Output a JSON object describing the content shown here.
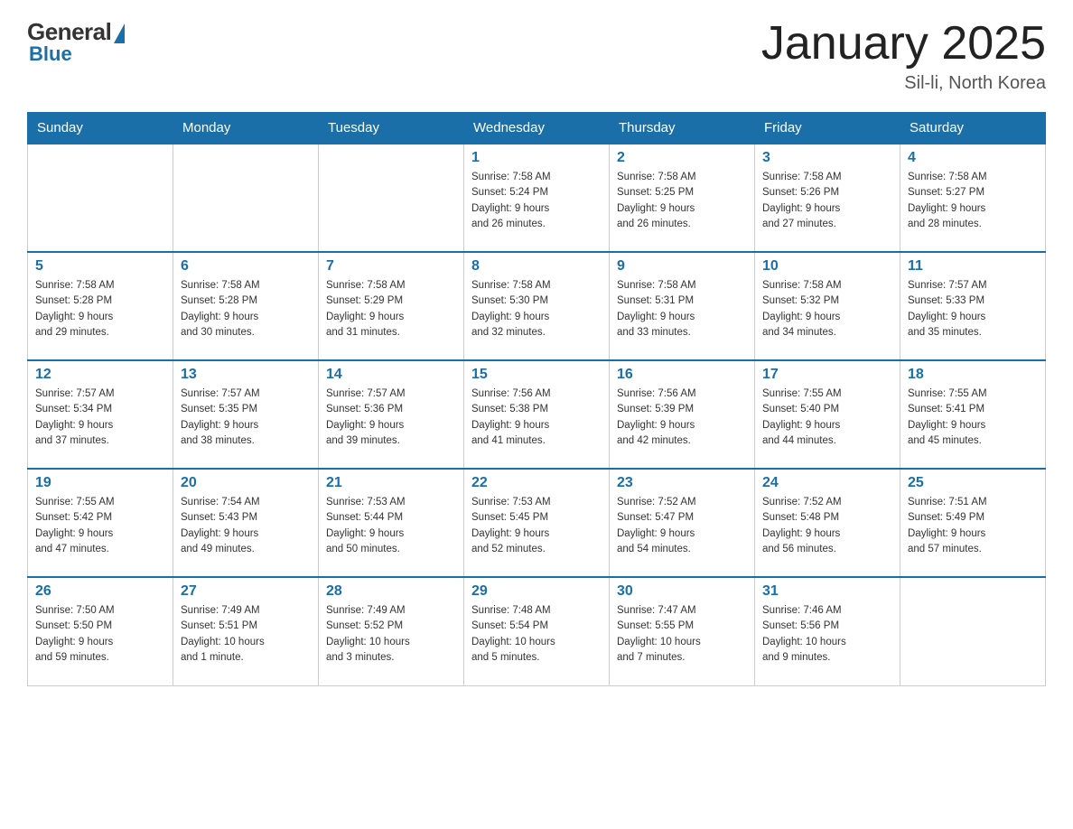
{
  "header": {
    "logo_general": "General",
    "logo_blue": "Blue",
    "month_title": "January 2025",
    "location": "Sil-li, North Korea"
  },
  "days_of_week": [
    "Sunday",
    "Monday",
    "Tuesday",
    "Wednesday",
    "Thursday",
    "Friday",
    "Saturday"
  ],
  "weeks": [
    [
      {
        "day": "",
        "info": ""
      },
      {
        "day": "",
        "info": ""
      },
      {
        "day": "",
        "info": ""
      },
      {
        "day": "1",
        "info": "Sunrise: 7:58 AM\nSunset: 5:24 PM\nDaylight: 9 hours\nand 26 minutes."
      },
      {
        "day": "2",
        "info": "Sunrise: 7:58 AM\nSunset: 5:25 PM\nDaylight: 9 hours\nand 26 minutes."
      },
      {
        "day": "3",
        "info": "Sunrise: 7:58 AM\nSunset: 5:26 PM\nDaylight: 9 hours\nand 27 minutes."
      },
      {
        "day": "4",
        "info": "Sunrise: 7:58 AM\nSunset: 5:27 PM\nDaylight: 9 hours\nand 28 minutes."
      }
    ],
    [
      {
        "day": "5",
        "info": "Sunrise: 7:58 AM\nSunset: 5:28 PM\nDaylight: 9 hours\nand 29 minutes."
      },
      {
        "day": "6",
        "info": "Sunrise: 7:58 AM\nSunset: 5:28 PM\nDaylight: 9 hours\nand 30 minutes."
      },
      {
        "day": "7",
        "info": "Sunrise: 7:58 AM\nSunset: 5:29 PM\nDaylight: 9 hours\nand 31 minutes."
      },
      {
        "day": "8",
        "info": "Sunrise: 7:58 AM\nSunset: 5:30 PM\nDaylight: 9 hours\nand 32 minutes."
      },
      {
        "day": "9",
        "info": "Sunrise: 7:58 AM\nSunset: 5:31 PM\nDaylight: 9 hours\nand 33 minutes."
      },
      {
        "day": "10",
        "info": "Sunrise: 7:58 AM\nSunset: 5:32 PM\nDaylight: 9 hours\nand 34 minutes."
      },
      {
        "day": "11",
        "info": "Sunrise: 7:57 AM\nSunset: 5:33 PM\nDaylight: 9 hours\nand 35 minutes."
      }
    ],
    [
      {
        "day": "12",
        "info": "Sunrise: 7:57 AM\nSunset: 5:34 PM\nDaylight: 9 hours\nand 37 minutes."
      },
      {
        "day": "13",
        "info": "Sunrise: 7:57 AM\nSunset: 5:35 PM\nDaylight: 9 hours\nand 38 minutes."
      },
      {
        "day": "14",
        "info": "Sunrise: 7:57 AM\nSunset: 5:36 PM\nDaylight: 9 hours\nand 39 minutes."
      },
      {
        "day": "15",
        "info": "Sunrise: 7:56 AM\nSunset: 5:38 PM\nDaylight: 9 hours\nand 41 minutes."
      },
      {
        "day": "16",
        "info": "Sunrise: 7:56 AM\nSunset: 5:39 PM\nDaylight: 9 hours\nand 42 minutes."
      },
      {
        "day": "17",
        "info": "Sunrise: 7:55 AM\nSunset: 5:40 PM\nDaylight: 9 hours\nand 44 minutes."
      },
      {
        "day": "18",
        "info": "Sunrise: 7:55 AM\nSunset: 5:41 PM\nDaylight: 9 hours\nand 45 minutes."
      }
    ],
    [
      {
        "day": "19",
        "info": "Sunrise: 7:55 AM\nSunset: 5:42 PM\nDaylight: 9 hours\nand 47 minutes."
      },
      {
        "day": "20",
        "info": "Sunrise: 7:54 AM\nSunset: 5:43 PM\nDaylight: 9 hours\nand 49 minutes."
      },
      {
        "day": "21",
        "info": "Sunrise: 7:53 AM\nSunset: 5:44 PM\nDaylight: 9 hours\nand 50 minutes."
      },
      {
        "day": "22",
        "info": "Sunrise: 7:53 AM\nSunset: 5:45 PM\nDaylight: 9 hours\nand 52 minutes."
      },
      {
        "day": "23",
        "info": "Sunrise: 7:52 AM\nSunset: 5:47 PM\nDaylight: 9 hours\nand 54 minutes."
      },
      {
        "day": "24",
        "info": "Sunrise: 7:52 AM\nSunset: 5:48 PM\nDaylight: 9 hours\nand 56 minutes."
      },
      {
        "day": "25",
        "info": "Sunrise: 7:51 AM\nSunset: 5:49 PM\nDaylight: 9 hours\nand 57 minutes."
      }
    ],
    [
      {
        "day": "26",
        "info": "Sunrise: 7:50 AM\nSunset: 5:50 PM\nDaylight: 9 hours\nand 59 minutes."
      },
      {
        "day": "27",
        "info": "Sunrise: 7:49 AM\nSunset: 5:51 PM\nDaylight: 10 hours\nand 1 minute."
      },
      {
        "day": "28",
        "info": "Sunrise: 7:49 AM\nSunset: 5:52 PM\nDaylight: 10 hours\nand 3 minutes."
      },
      {
        "day": "29",
        "info": "Sunrise: 7:48 AM\nSunset: 5:54 PM\nDaylight: 10 hours\nand 5 minutes."
      },
      {
        "day": "30",
        "info": "Sunrise: 7:47 AM\nSunset: 5:55 PM\nDaylight: 10 hours\nand 7 minutes."
      },
      {
        "day": "31",
        "info": "Sunrise: 7:46 AM\nSunset: 5:56 PM\nDaylight: 10 hours\nand 9 minutes."
      },
      {
        "day": "",
        "info": ""
      }
    ]
  ]
}
